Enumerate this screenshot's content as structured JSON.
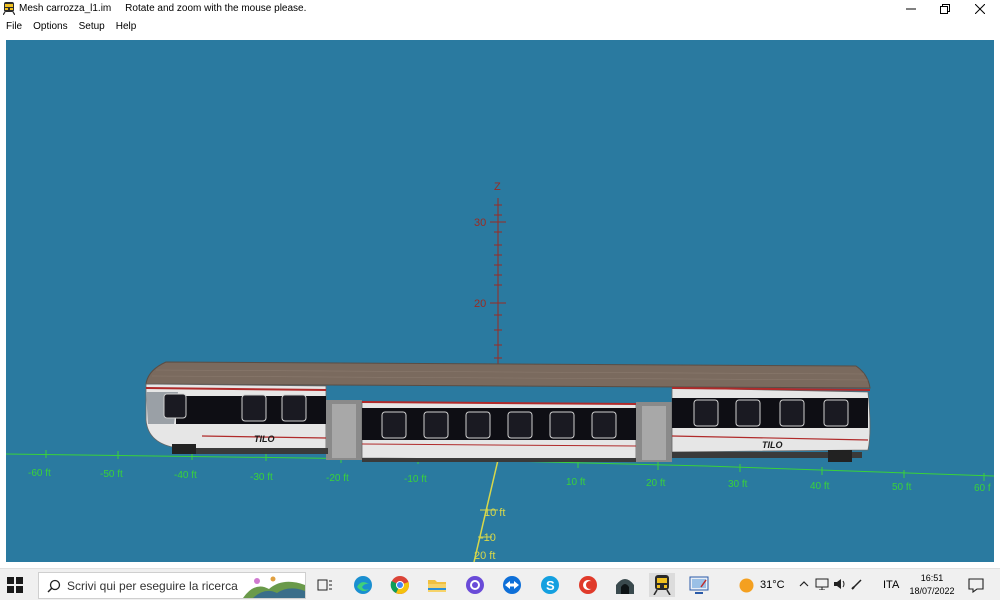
{
  "window": {
    "title": "Mesh carrozza_l1.im",
    "subtitle": "Rotate and zoom with the mouse please."
  },
  "menu": [
    "File",
    "Options",
    "Setup",
    "Help"
  ],
  "viewport": {
    "background": "#2a7aa0",
    "z_axis_label": "Z",
    "z_ticks": [
      "30",
      "20"
    ],
    "x_ticks": [
      "-60 ft",
      "-50 ft",
      "-40 ft",
      "-30 ft",
      "-20 ft",
      "-10 ft",
      "10 ft",
      "20 ft",
      "30 ft",
      "40 ft",
      "50 ft",
      "60 f"
    ],
    "y_ticks": [
      "10 ft",
      "-10",
      "20 ft"
    ],
    "model_livery": "TILO"
  },
  "taskbar": {
    "search_placeholder": "Scrivi qui per eseguire la ricerca",
    "weather": "31°C",
    "language": "ITA",
    "time": "16:51",
    "date": "18/07/2022"
  },
  "colors": {
    "axis_ground": "#39d23a",
    "axis_z": "#9a2b22",
    "axis_y": "#d8d84a"
  }
}
